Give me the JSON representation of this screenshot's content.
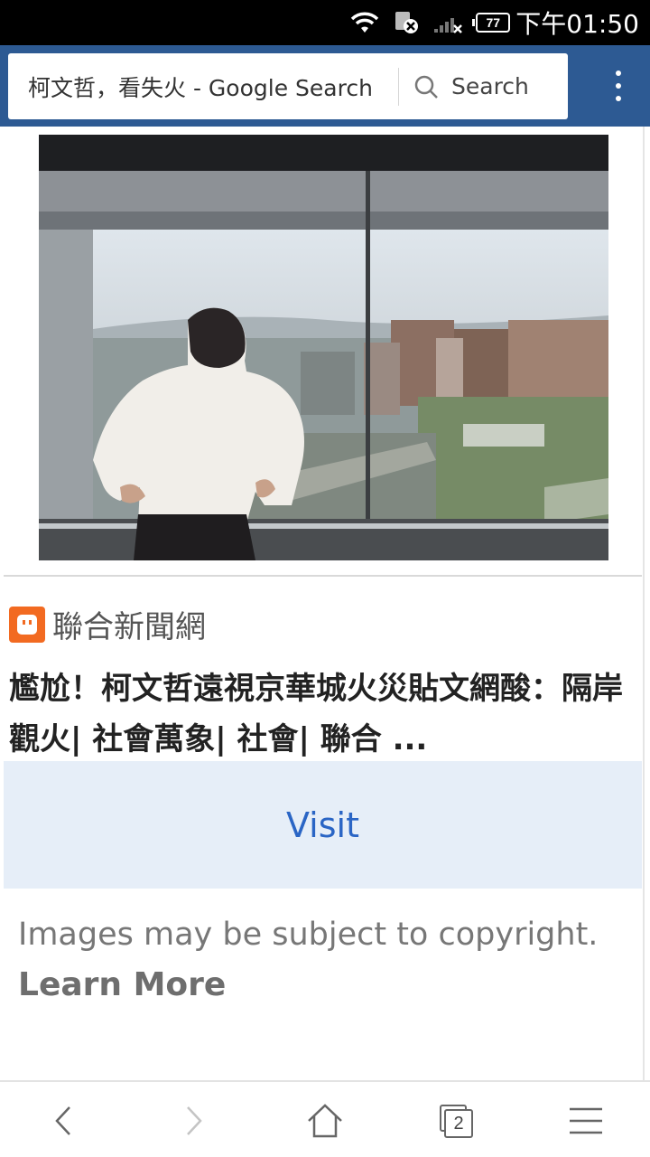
{
  "status_bar": {
    "battery": "77",
    "time": "下午01:50",
    "icons": [
      "wifi-icon",
      "sim-blocked-icon",
      "signal-off-icon",
      "battery-icon"
    ]
  },
  "toolbar": {
    "url_text": "柯文哲，看失火 - Google Search",
    "search_label": "Search",
    "icons": [
      "search-icon",
      "overflow-menu-icon"
    ],
    "background_color": "#2d5a93"
  },
  "result": {
    "source_name": "聯合新聞網",
    "source_icon": "udn-logo-icon",
    "title": "尷尬！柯文哲遠視京華城火災貼文網酸：隔岸觀火| 社會萬象| 社會| 聯合 ...",
    "visit_label": "Visit",
    "visit_color": "#2a65c5",
    "copyright_text": "Images may be subject to copyright.",
    "learn_more": "Learn More"
  },
  "bottom_nav": {
    "items": [
      "back-arrow-icon",
      "forward-arrow-icon",
      "home-icon",
      "tabs-icon",
      "hamburger-menu-icon"
    ],
    "tab_count": "2"
  }
}
